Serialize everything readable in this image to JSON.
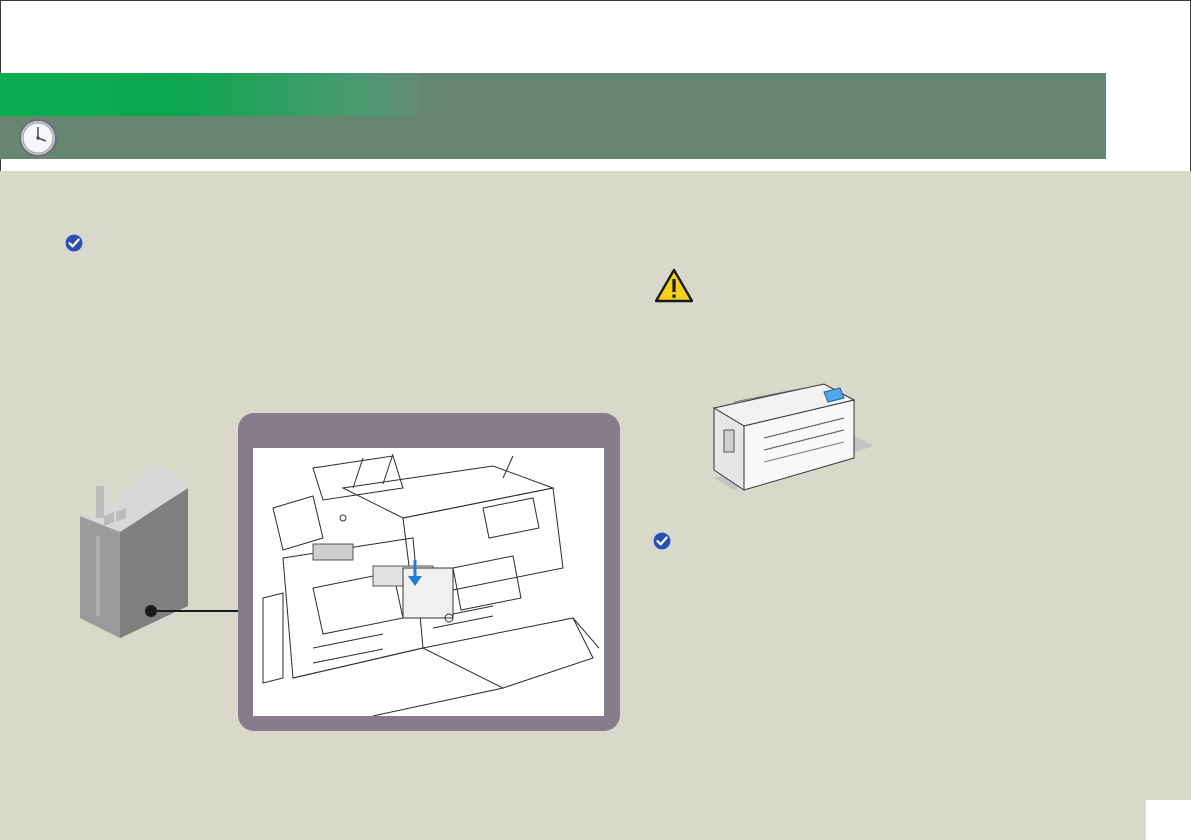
{
  "header": {
    "title": "",
    "section_label": ""
  },
  "icons": {
    "clock": "clock-icon",
    "check_1": "check-badge-icon",
    "check_2": "check-badge-icon",
    "warning": "warning-icon"
  },
  "colors": {
    "header_band": "#678670",
    "header_tab": "#07ad4f",
    "content_bg": "#d9d9cb",
    "callout_frame": "#877c8c",
    "check_blue": "#2a4fb0",
    "warning_yellow": "#f4d21c",
    "arrow_blue": "#1f7fd6"
  },
  "left_column": {
    "note_text": ""
  },
  "right_column": {
    "warning_text": "",
    "note_text": ""
  },
  "footer": {
    "page_number": ""
  }
}
